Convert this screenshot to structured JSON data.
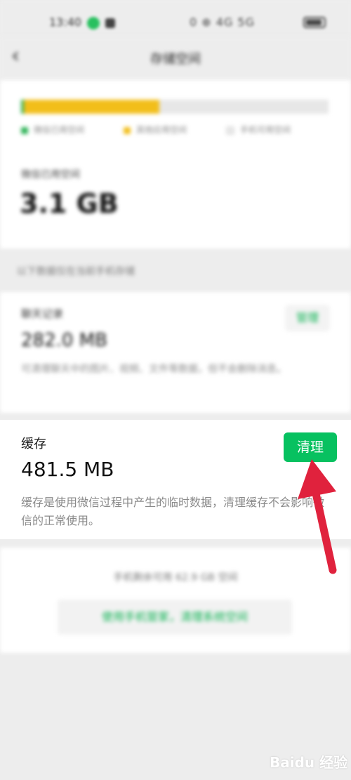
{
  "status_bar": {
    "time": "13:40",
    "right_text": "0 ⊕ 4G 5G",
    "battery": "battery"
  },
  "header": {
    "back_label": "‹",
    "title": "存储空间"
  },
  "storage": {
    "legend": {
      "wechat": "微信已用空间",
      "other": "其他应用空间",
      "free": "手机可用空间"
    },
    "wechat_label": "微信已用空间",
    "wechat_size": "3.1 GB",
    "usage_fraction_green": 0.01,
    "usage_fraction_yellow": 0.44,
    "colors": {
      "green": "#32b45a",
      "yellow": "#f2be1a",
      "track": "#e7e7e7"
    }
  },
  "section_label": "以下数据仅在当前手机存储",
  "chat": {
    "title": "聊天记录",
    "size": "282.0 MB",
    "description": "可清理聊天中的图片、视频、文件等数据，但不会删除消息。",
    "manage_label": "管理"
  },
  "cache": {
    "title": "缓存",
    "size": "481.5 MB",
    "description": "缓存是使用微信过程中产生的临时数据，清理缓存不会影响微信的正常使用。",
    "clear_label": "清理"
  },
  "bottom": {
    "available_text": "手机剩余可用 62.9 GB 空间",
    "button_label": "使用手机管家，清理系统空间"
  },
  "watermark": {
    "text": "Baidu 经验"
  }
}
